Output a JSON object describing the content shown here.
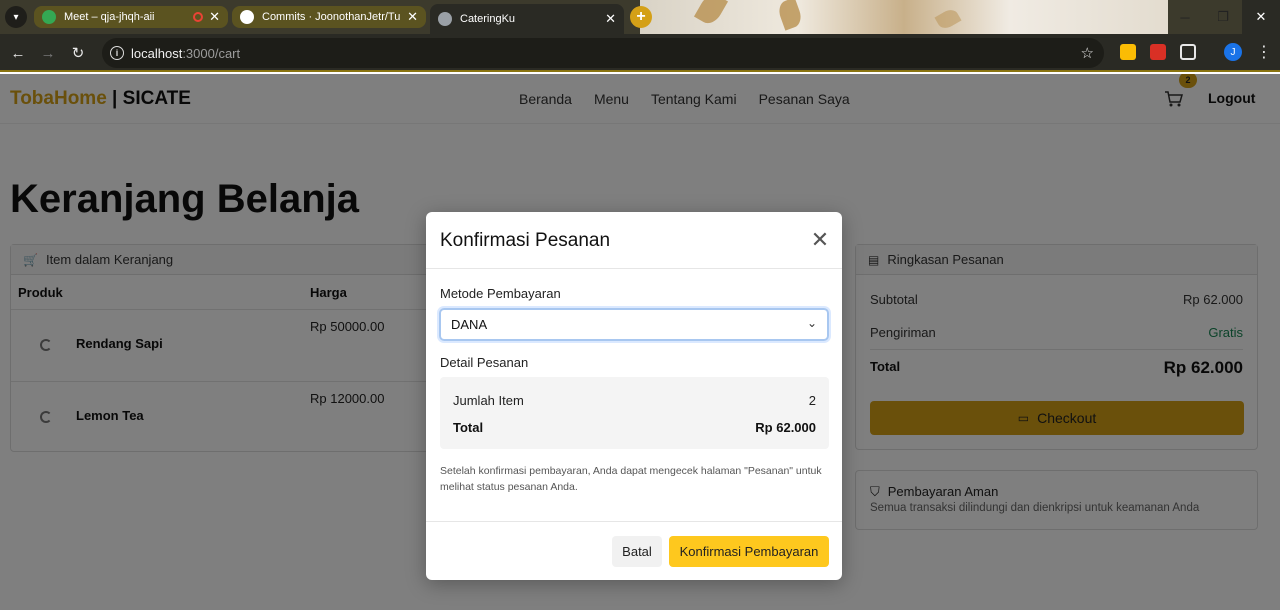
{
  "browser": {
    "tabs": [
      {
        "title": "Meet – qja-jhqh-aii",
        "active": false
      },
      {
        "title": "Commits · JoonothanJetr/Tuber",
        "active": false
      },
      {
        "title": "CateringKu",
        "active": true
      }
    ],
    "url_host": "localhost",
    "url_path": ":3000/cart",
    "profile_initial": "J"
  },
  "site": {
    "brand_first": "TobaHome",
    "brand_sep": " | ",
    "brand_second": "SICATE",
    "nav": [
      "Beranda",
      "Menu",
      "Tentang Kami",
      "Pesanan Saya"
    ],
    "cart_count": "2",
    "logout": "Logout"
  },
  "cart": {
    "page_title": "Keranjang Belanja",
    "items_header": "Item dalam Keranjang",
    "columns": [
      "Produk",
      "Harga"
    ],
    "items": [
      {
        "name": "Rendang Sapi",
        "price": "Rp 50000.00"
      },
      {
        "name": "Lemon Tea",
        "price": "Rp 12000.00"
      }
    ]
  },
  "summary": {
    "header": "Ringkasan Pesanan",
    "subtotal_label": "Subtotal",
    "subtotal_value": "Rp 62.000",
    "shipping_label": "Pengiriman",
    "shipping_value": "Gratis",
    "total_label": "Total",
    "total_value": "Rp 62.000",
    "checkout": "Checkout"
  },
  "secure": {
    "title": "Pembayaran Aman",
    "text": "Semua transaksi dilindungi dan dienkripsi untuk keamanan Anda"
  },
  "modal": {
    "title": "Konfirmasi Pesanan",
    "method_label": "Metode Pembayaran",
    "method_value": "DANA",
    "detail_label": "Detail Pesanan",
    "item_count_label": "Jumlah Item",
    "item_count_value": "2",
    "total_label": "Total",
    "total_value": "Rp 62.000",
    "note": "Setelah konfirmasi pembayaran, Anda dapat mengecek halaman \"Pesanan\" untuk melihat status pesanan Anda.",
    "cancel": "Batal",
    "confirm": "Konfirmasi Pembayaran"
  },
  "colors": {
    "accent": "#d4a017",
    "confirm_button": "#fec81e",
    "success": "#198754"
  }
}
